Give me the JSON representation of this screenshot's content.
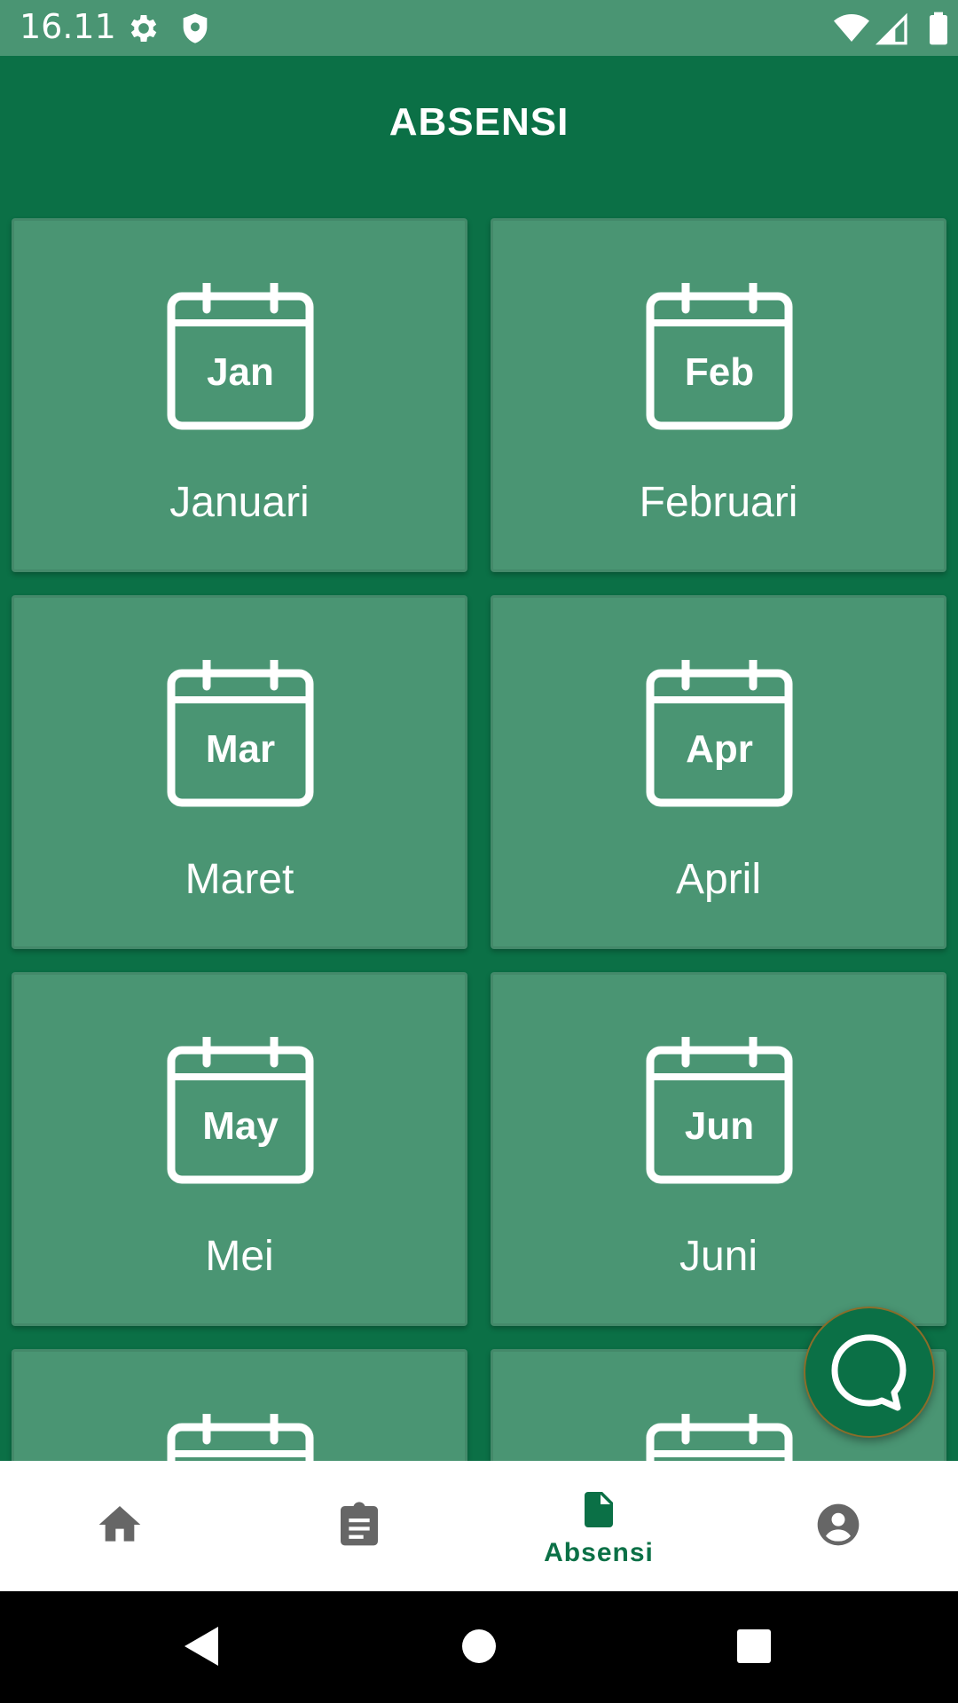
{
  "status_bar": {
    "time": "16.11",
    "icons": [
      "gear-icon",
      "shield-icon",
      "wifi-icon",
      "signal-icon",
      "battery-icon"
    ]
  },
  "app_bar": {
    "title": "ABSENSI"
  },
  "months": [
    {
      "abbr": "Jan",
      "label": "Januari"
    },
    {
      "abbr": "Feb",
      "label": "Februari"
    },
    {
      "abbr": "Mar",
      "label": "Maret"
    },
    {
      "abbr": "Apr",
      "label": "April"
    },
    {
      "abbr": "May",
      "label": "Mei"
    },
    {
      "abbr": "Jun",
      "label": "Juni"
    },
    {
      "abbr": "",
      "label": ""
    },
    {
      "abbr": "",
      "label": ""
    }
  ],
  "bottom_nav": {
    "items": [
      {
        "icon": "home-icon",
        "label": "",
        "active": false
      },
      {
        "icon": "clipboard-icon",
        "label": "",
        "active": false
      },
      {
        "icon": "document-icon",
        "label": "Absensi",
        "active": true
      },
      {
        "icon": "account-icon",
        "label": "",
        "active": false
      }
    ]
  },
  "colors": {
    "primary": "#0b7046",
    "card": "#4a9573",
    "status_bar": "#4a9573",
    "inactive_icon": "#666666"
  }
}
